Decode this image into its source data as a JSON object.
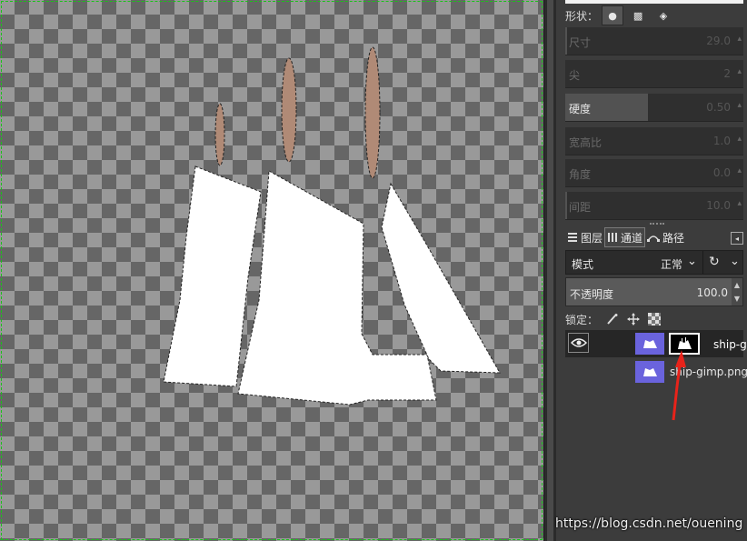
{
  "tool_options": {
    "shape_label": "形状：",
    "shape_options": [
      {
        "icon": "circle-shape-icon",
        "active": true
      },
      {
        "icon": "square-shape-icon",
        "active": false
      },
      {
        "icon": "diamond-shape-icon",
        "active": false
      }
    ],
    "sliders": [
      {
        "label": "尺寸",
        "value": "29.0",
        "fill": 0.01,
        "enabled": false
      },
      {
        "label": "尖",
        "value": "2",
        "fill": 0.0,
        "enabled": false
      },
      {
        "label": "硬度",
        "value": "0.50",
        "fill": 0.5,
        "enabled": true
      },
      {
        "label": "宽高比",
        "value": "1.0",
        "fill": 0.0,
        "enabled": false
      },
      {
        "label": "角度",
        "value": "0.0",
        "fill": 0.0,
        "enabled": false
      },
      {
        "label": "间距",
        "value": "10.0",
        "fill": 0.01,
        "enabled": false
      }
    ]
  },
  "dock_tabs": [
    {
      "label": "图层",
      "icon": "layers-icon",
      "active": true
    },
    {
      "label": "通道",
      "icon": "channels-icon",
      "active": false
    },
    {
      "label": "路径",
      "icon": "paths-icon",
      "active": false
    }
  ],
  "layers_panel": {
    "mode_label": "模式",
    "mode_value": "正常",
    "opacity_label": "不透明度",
    "opacity_value": "100.0",
    "lock_label": "锁定：",
    "layers": [
      {
        "name": "ship-gimp",
        "visible": true,
        "has_mask": true,
        "selected": true
      },
      {
        "name": "ship-gimp.png",
        "visible": false,
        "has_mask": false,
        "selected": false
      }
    ]
  },
  "colors": {
    "selection_accent": "#19c319",
    "sail": "#ffffff",
    "mast": "#b08a76",
    "thumbnail_bg": "#6a63dd",
    "annotation_arrow": "#e8231a"
  },
  "watermark": "https://blog.csdn.net/ouening"
}
